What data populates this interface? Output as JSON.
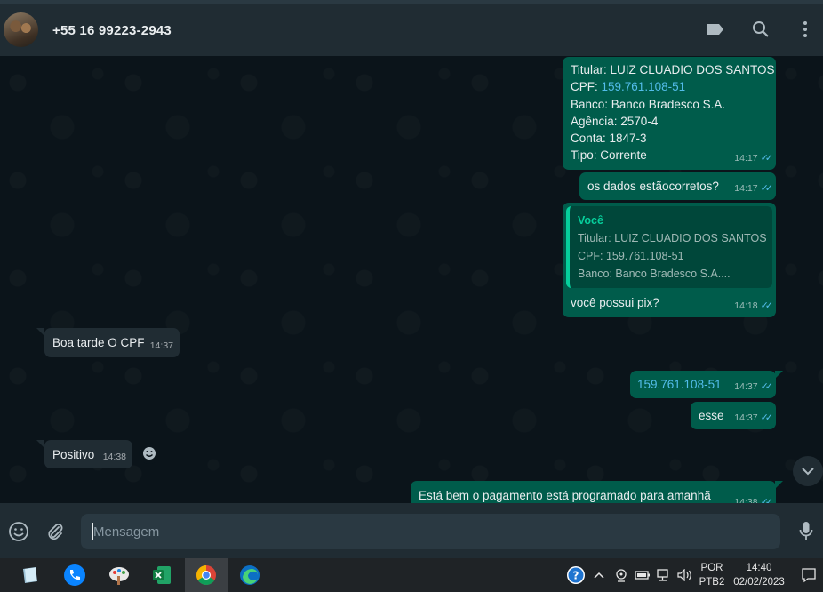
{
  "header": {
    "contact": "+55 16 99223-2943"
  },
  "messages": {
    "bank_details": {
      "lines": [
        "Titular: LUIZ CLUADIO DOS SANTOS",
        "CPF: ",
        "Banco: Banco Bradesco S.A.",
        "Agência: 2570-4",
        "Conta: 1847-3",
        "Tipo: Corrente"
      ],
      "cpf_link": "159.761.108-51",
      "time": "14:17"
    },
    "data_check": {
      "text": "os dados estãocorretos?",
      "time": "14:17"
    },
    "pix_reply": {
      "quote_author": "Você",
      "quote_lines": [
        "Titular: LUIZ CLUADIO DOS SANTOS",
        "CPF: 159.761.108-51",
        "Banco: Banco Bradesco S.A...."
      ],
      "text": "você possui pix?",
      "time": "14:18"
    },
    "incoming_cpf": {
      "text": "Boa tarde O CPF",
      "time": "14:37"
    },
    "cpf_sent": {
      "text": "159.761.108-51",
      "time": "14:37"
    },
    "esse": {
      "text": "esse",
      "time": "14:37"
    },
    "positivo": {
      "text": "Positivo",
      "time": "14:38"
    },
    "payment": {
      "text": "Está bem o pagamento está programado para amanhã",
      "time": "14:38"
    }
  },
  "compose": {
    "placeholder": "Mensagem"
  },
  "taskbar": {
    "lang_top": "POR",
    "lang_bottom": "PTB2",
    "clock_time": "14:40",
    "clock_date": "02/02/2023"
  },
  "colors": {
    "outgoing_bubble": "#005c4b",
    "incoming_bubble": "#202c33",
    "read_tick": "#53bdeb",
    "quote_accent": "#06cf9c"
  },
  "icons": [
    "label-icon",
    "search-icon",
    "menu-icon",
    "emoji-icon",
    "attach-icon",
    "mic-icon",
    "chevron-down-icon",
    "reaction-icon"
  ]
}
